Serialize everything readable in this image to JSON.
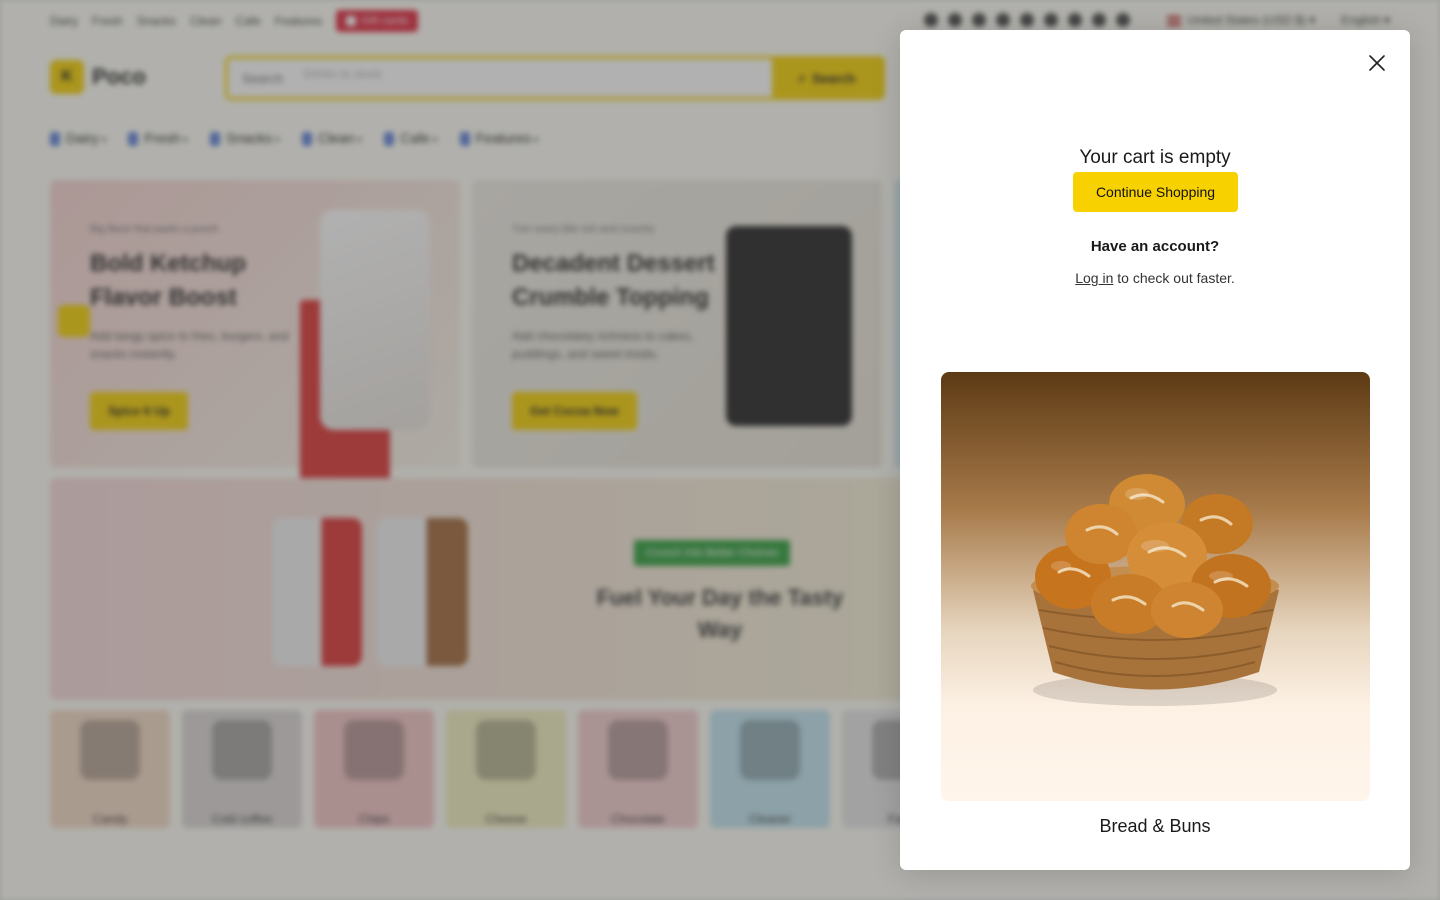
{
  "topbar": {
    "links": [
      "Dairy",
      "Fresh",
      "Snacks",
      "Clean",
      "Cafe",
      "Features"
    ],
    "gift_label": "Gift cards",
    "country": "United States (USD $)",
    "language": "English"
  },
  "header": {
    "logo": "Poco",
    "search_label": "Search",
    "search_placeholder": "Drinks to stock",
    "search_button": "Search"
  },
  "nav": {
    "items": [
      "Dairy",
      "Fresh",
      "Snacks",
      "Clean",
      "Cafe",
      "Features"
    ]
  },
  "banners": [
    {
      "eyebrow": "Big flavor that packs a punch",
      "title": "Bold Ketchup Flavor Boost",
      "text": "Add tangy spice to fries, burgers, and snacks instantly.",
      "button": "Spice It Up"
    },
    {
      "eyebrow": "Turn every bite rich and crunchy",
      "title": "Decadent Dessert Crumble Topping",
      "text": "Add chocolatey richness to cakes, puddings, and sweet treats.",
      "button": "Get Cocoa Now"
    }
  ],
  "wide_banner": {
    "badge": "Crunch Into Better Choices",
    "title": "Fuel Your Day the Tasty Way"
  },
  "categories": [
    "Candy",
    "Cold coffee",
    "Chips",
    "Cheese",
    "Chocolate",
    "Cleaner",
    "Farm"
  ],
  "cart": {
    "empty_title": "Your cart is empty",
    "continue_button": "Continue Shopping",
    "account_question": "Have an account?",
    "login_link": "Log in",
    "login_suffix": "to check out faster.",
    "promo_caption": "Bread & Buns"
  },
  "colors": {
    "accent": "#f8d200",
    "gift": "#e0243a"
  }
}
